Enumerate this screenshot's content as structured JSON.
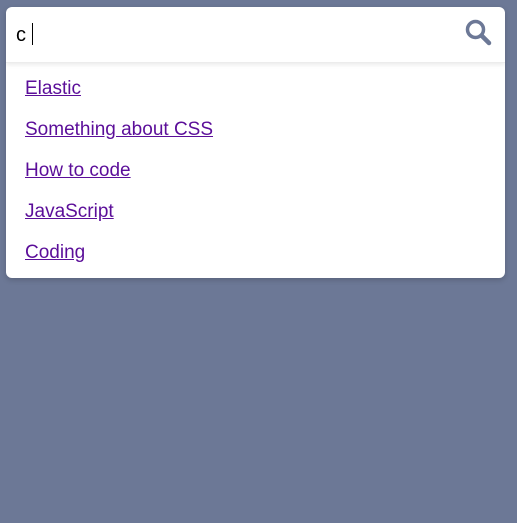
{
  "theme": {
    "background": "#6c7896",
    "panel": "#ffffff",
    "link": "#5b0e99",
    "icon": "#6c7896"
  },
  "search": {
    "value": "c",
    "icon": "search-icon"
  },
  "results": [
    {
      "label": "Elastic"
    },
    {
      "label": "Something about CSS"
    },
    {
      "label": "How to code"
    },
    {
      "label": "JavaScript"
    },
    {
      "label": "Coding"
    }
  ]
}
